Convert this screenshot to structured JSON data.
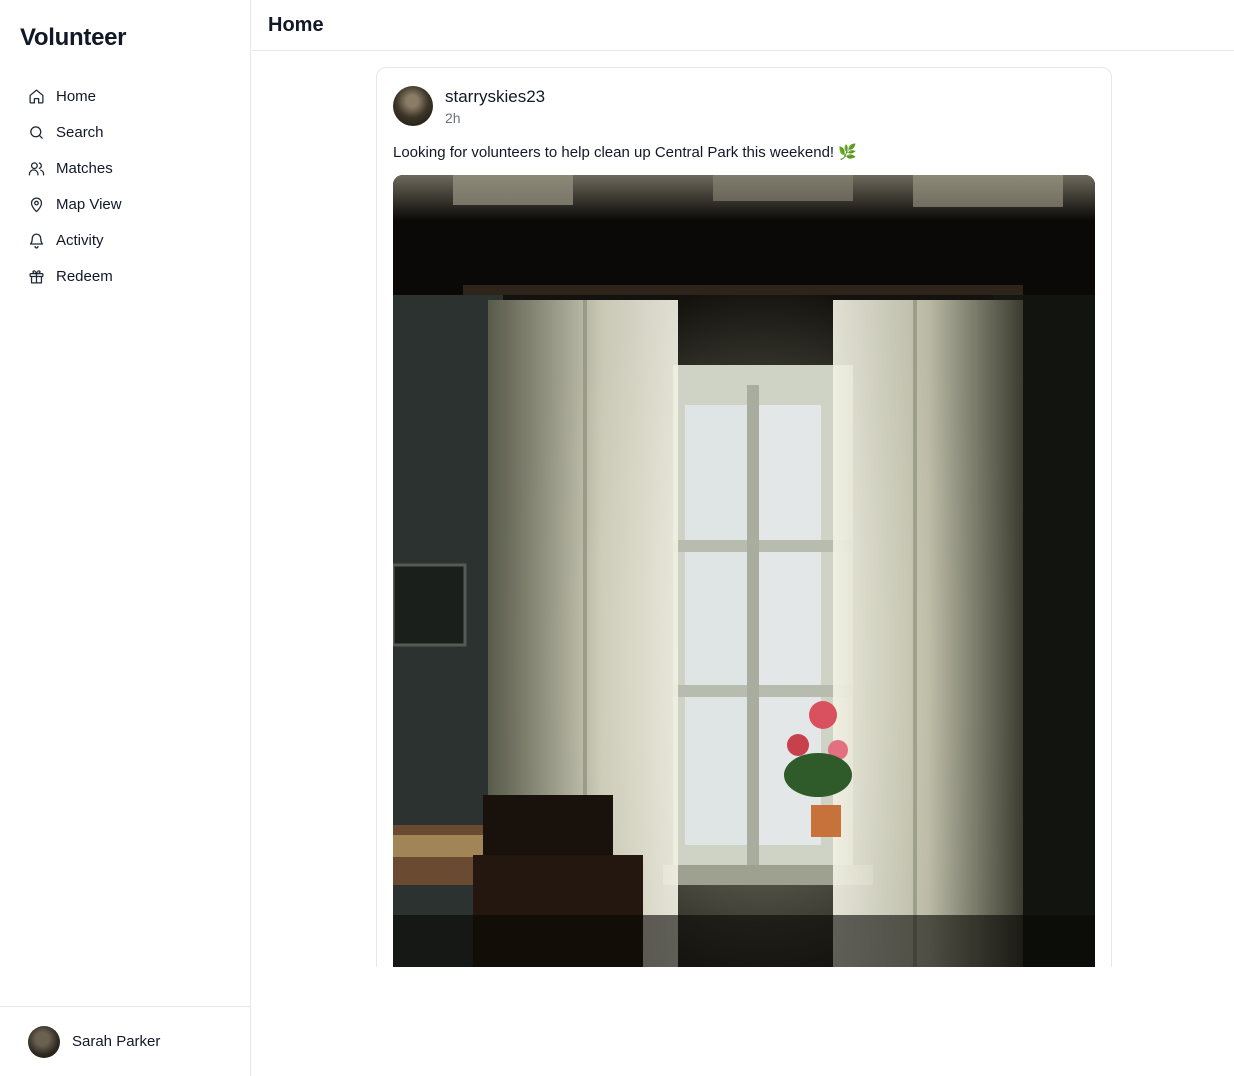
{
  "app": {
    "brand": "Volunteer"
  },
  "sidebar": {
    "items": [
      {
        "label": "Home",
        "icon": "home-icon"
      },
      {
        "label": "Search",
        "icon": "search-icon"
      },
      {
        "label": "Matches",
        "icon": "users-icon"
      },
      {
        "label": "Map View",
        "icon": "map-pin-icon"
      },
      {
        "label": "Activity",
        "icon": "bell-icon"
      },
      {
        "label": "Redeem",
        "icon": "gift-icon"
      }
    ],
    "user": {
      "name": "Sarah Parker"
    }
  },
  "header": {
    "title": "Home"
  },
  "feed": {
    "posts": [
      {
        "username": "starryskies23",
        "time": "2h",
        "text": "Looking for volunteers to help clean up Central Park this weekend! 🌿"
      }
    ]
  }
}
